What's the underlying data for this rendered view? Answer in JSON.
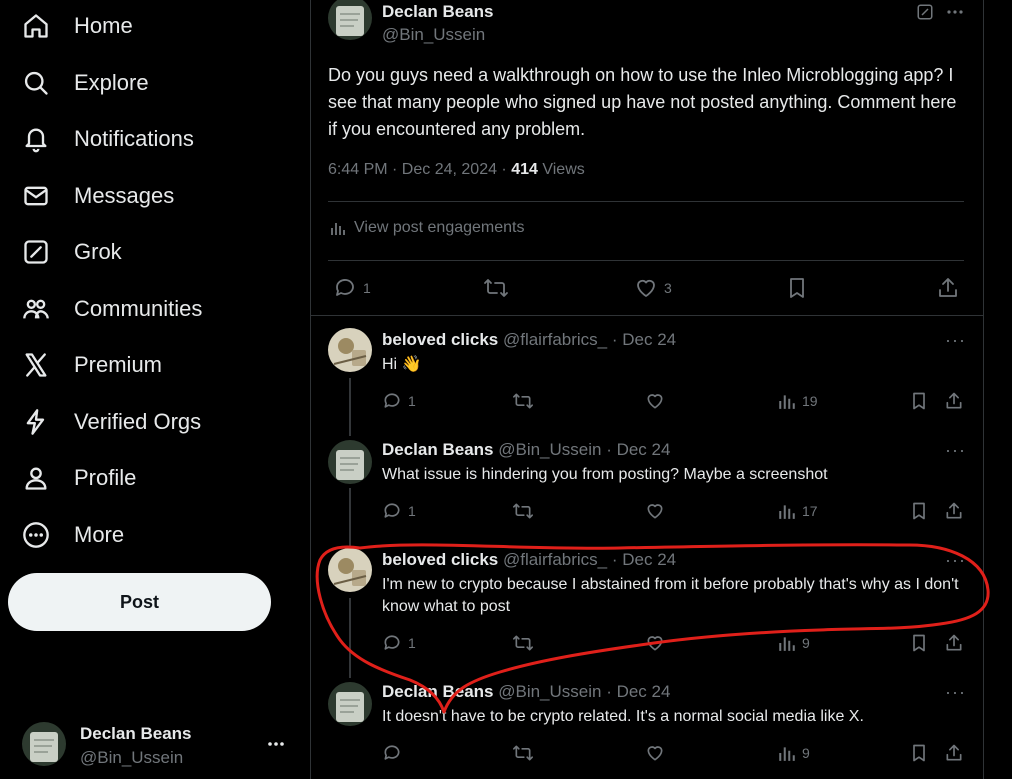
{
  "nav": {
    "items": [
      {
        "label": "Home",
        "icon": "home-icon"
      },
      {
        "label": "Explore",
        "icon": "search-icon"
      },
      {
        "label": "Notifications",
        "icon": "bell-icon"
      },
      {
        "label": "Messages",
        "icon": "envelope-icon"
      },
      {
        "label": "Grok",
        "icon": "grok-icon"
      },
      {
        "label": "Communities",
        "icon": "people-icon"
      },
      {
        "label": "Premium",
        "icon": "x-logo-icon"
      },
      {
        "label": "Verified Orgs",
        "icon": "lightning-icon"
      },
      {
        "label": "Profile",
        "icon": "person-icon"
      },
      {
        "label": "More",
        "icon": "more-circle-icon"
      }
    ],
    "post_label": "Post"
  },
  "account": {
    "name": "Declan Beans",
    "handle": "@Bin_Ussein"
  },
  "main_post": {
    "name": "Declan Beans",
    "handle": "@Bin_Ussein",
    "text": "Do you guys need a walkthrough on how to use the Inleo Microblogging app? I see that many people who signed up have not posted anything. Comment here if you encountered any problem.",
    "time": "6:44 PM · Dec 24, 2024 · ",
    "views_count": "414",
    "views_label": " Views",
    "engagements_label": "View post engagements",
    "replies": "1",
    "likes": "3"
  },
  "replies": [
    {
      "name": "beloved clicks",
      "meta": " @flairfabrics_ · Dec 24",
      "text": "Hi 👋",
      "reply_count": "1",
      "views": "19"
    },
    {
      "name": "Declan Beans",
      "meta": " @Bin_Ussein · Dec 24",
      "text": "What issue is hindering you from posting? Maybe a screenshot",
      "reply_count": "1",
      "views": "17"
    },
    {
      "name": "beloved clicks",
      "meta": " @flairfabrics_ · Dec 24",
      "text": "I'm new to crypto because I abstained from it before probably that's why as I don't know what to post",
      "reply_count": "1",
      "views": "9"
    },
    {
      "name": "Declan Beans",
      "meta": " @Bin_Ussein · Dec 24",
      "text": "It doesn't have to be crypto related. It's a normal social media like X.",
      "reply_count": "",
      "views": "9"
    }
  ],
  "colors": {
    "background": "#000000",
    "text": "#e7e9ea",
    "muted": "#71767b",
    "border": "#2f3336",
    "annotation": "#e0201a",
    "post_button": "#eff3f4"
  }
}
